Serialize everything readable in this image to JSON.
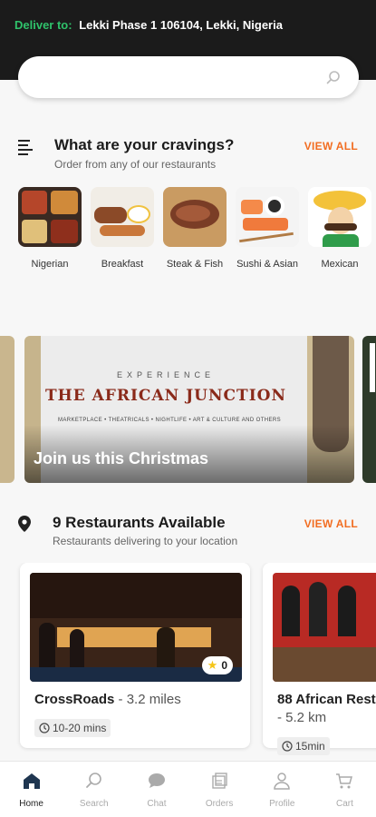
{
  "header": {
    "deliver_label": "Deliver to:",
    "address": "Lekki Phase 1 106104, Lekki, Nigeria"
  },
  "search": {
    "placeholder": "",
    "icon": "search-icon"
  },
  "cravings": {
    "title": "What are your cravings?",
    "subtitle": "Order from any of our restaurants",
    "view_all": "VIEW ALL",
    "items": [
      {
        "label": "Nigerian"
      },
      {
        "label": "Breakfast"
      },
      {
        "label": "Steak & Fish"
      },
      {
        "label": "Sushi & Asian"
      },
      {
        "label": "Mexican"
      }
    ]
  },
  "banner": {
    "kicker": "EXPERIENCE",
    "brand": "THE AFRICAN JUNCTION",
    "tagline": "MARKETPLACE • THEATRICALS • NIGHTLIFE • ART & CULTURE AND OTHERS",
    "cta": "Join us this Christmas"
  },
  "restaurants": {
    "title": "9 Restaurants Available",
    "subtitle": "Restaurants delivering to your location",
    "view_all": "VIEW ALL",
    "items": [
      {
        "name": "CrossRoads",
        "distance": "- 3.2 miles",
        "time": "10-20 mins",
        "rating": "0"
      },
      {
        "name": "88 African Rest",
        "distance": "- 5.2 km",
        "time": "15min",
        "rating": ""
      }
    ]
  },
  "nav": {
    "items": [
      {
        "label": "Home",
        "icon": "home-icon"
      },
      {
        "label": "Search",
        "icon": "search-icon"
      },
      {
        "label": "Chat",
        "icon": "chat-icon"
      },
      {
        "label": "Orders",
        "icon": "orders-icon"
      },
      {
        "label": "Profile",
        "icon": "profile-icon"
      },
      {
        "label": "Cart",
        "icon": "cart-icon"
      }
    ]
  },
  "colors": {
    "accent": "#f26d21",
    "deliver_green": "#2fc26b",
    "topbar": "#1b1b1b"
  }
}
